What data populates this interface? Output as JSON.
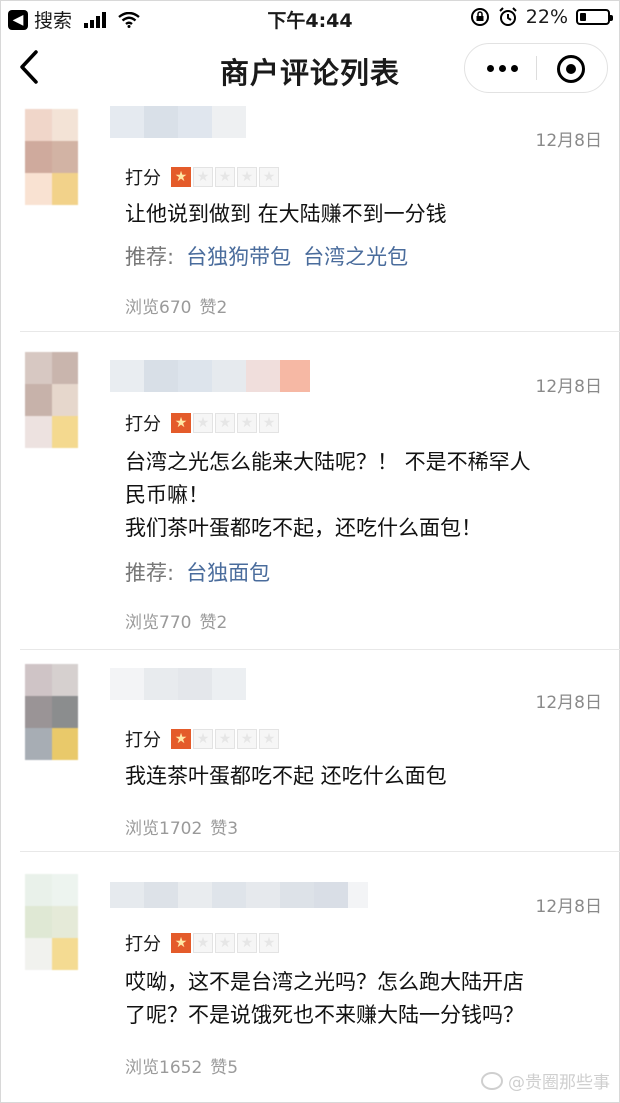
{
  "status_bar": {
    "back_app": "搜索",
    "time": "下午4:44",
    "battery_text": "22%",
    "battery_level": 0.22
  },
  "nav": {
    "title": "商户评论列表"
  },
  "reviews": [
    {
      "date": "12月8日",
      "score_label": "打分",
      "stars": 1,
      "content": [
        "让他说到做到 在大陆赚不到一分钱"
      ],
      "rec_label": "推荐:",
      "recs": [
        "台独狗带包",
        "台湾之光包"
      ],
      "views": "浏览670",
      "likes": "赞2"
    },
    {
      "date": "12月8日",
      "score_label": "打分",
      "stars": 1,
      "content": [
        "台湾之光怎么能来大陆呢？！ 不是不稀罕人",
        "民币嘛！",
        "我们茶叶蛋都吃不起，还吃什么面包！"
      ],
      "rec_label": "推荐:",
      "recs": [
        "台独面包"
      ],
      "views": "浏览770",
      "likes": "赞2"
    },
    {
      "date": "12月8日",
      "score_label": "打分",
      "stars": 1,
      "content": [
        "我连茶叶蛋都吃不起 还吃什么面包"
      ],
      "rec_label": "",
      "recs": [],
      "views": "浏览1702",
      "likes": "赞3"
    },
    {
      "date": "12月8日",
      "score_label": "打分",
      "stars": 1,
      "content": [
        "哎呦，这不是台湾之光吗？怎么跑大陆开店",
        "了呢？不是说饿死也不来赚大陆一分钱吗？"
      ],
      "rec_label": "",
      "recs": [],
      "views": "浏览1652",
      "likes": "赞5"
    }
  ],
  "watermark": "@贵圈那些事",
  "colors": {
    "star_active": "#e45b2a",
    "rec_link": "#4a6c9c"
  }
}
